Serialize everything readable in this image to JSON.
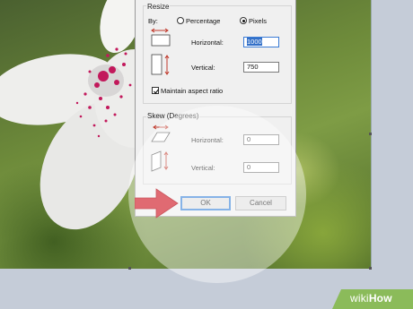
{
  "dialog": {
    "resize": {
      "title": "Resize",
      "by_label": "By:",
      "percentage_label": "Percentage",
      "pixels_label": "Pixels",
      "horizontal_label": "Horizontal:",
      "horizontal_value": "1000",
      "vertical_label": "Vertical:",
      "vertical_value": "750",
      "maintain_aspect_label": "Maintain aspect ratio",
      "maintain_aspect_checked": true,
      "selected_unit": "Pixels"
    },
    "skew": {
      "title": "Skew (Degrees)",
      "horizontal_label": "Horizontal:",
      "horizontal_value": "0",
      "vertical_label": "Vertical:",
      "vertical_value": "0"
    },
    "ok_label": "OK",
    "cancel_label": "Cancel"
  },
  "brand": {
    "prefix": "wiki",
    "name": "How"
  },
  "colors": {
    "arrow": "#e06a72",
    "dialog_bg": "#f0f0f0",
    "selection": "#3370c8",
    "brand_green": "#8bbb5a"
  }
}
